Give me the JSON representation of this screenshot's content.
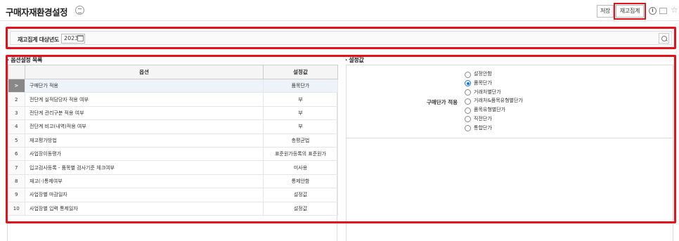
{
  "header": {
    "title": "구매자재환경설정",
    "title_icon": "list-icon",
    "buttons": {
      "save": "저장",
      "stock_calc": "재고집계"
    },
    "icons": [
      "info-icon",
      "mail-icon",
      "star-icon"
    ],
    "info_glyph": "i",
    "star_glyph": "☆"
  },
  "search": {
    "label": "재고집계 대상년도",
    "year": "2023"
  },
  "left_panel": {
    "title": "· 옵션설정 목록",
    "columns": {
      "option": "옵션",
      "value": "설정값"
    },
    "rows": [
      {
        "num": ">",
        "name": "구매단가 적용",
        "value": "품목단가",
        "selected": true
      },
      {
        "num": "2",
        "name": "전단계 실적담당자 적용 여부",
        "value": "부"
      },
      {
        "num": "3",
        "name": "전단계 관리구분 적용 여부",
        "value": "부"
      },
      {
        "num": "4",
        "name": "전단계 비고(내역)적용 여부",
        "value": "부"
      },
      {
        "num": "5",
        "name": "재고평가방법",
        "value": "총평균법"
      },
      {
        "num": "6",
        "name": "사업장이동평가",
        "value": "표준원가등록의 표준원가"
      },
      {
        "num": "7",
        "name": "입고검사등록 - 품목별 검사기준 체크여부",
        "value": "미사용"
      },
      {
        "num": "8",
        "name": "재고(-)통제여부",
        "value": "통제안함"
      },
      {
        "num": "9",
        "name": "사업장별 마감일자",
        "value": "설정값"
      },
      {
        "num": "10",
        "name": "사업장별 입력 통제일자",
        "value": "설정값"
      }
    ]
  },
  "right_panel": {
    "title": "· 설정값",
    "setting_label": "구매단가 적용",
    "options": [
      {
        "label": "설정안함",
        "checked": false
      },
      {
        "label": "품목단가",
        "checked": true
      },
      {
        "label": "거래처별단가",
        "checked": false
      },
      {
        "label": "거래처&품목유형별단가",
        "checked": false
      },
      {
        "label": "품목유형별단가",
        "checked": false
      },
      {
        "label": "직전단가",
        "checked": false
      },
      {
        "label": "통합단가",
        "checked": false
      }
    ]
  },
  "colors": {
    "highlight": "#e3121b",
    "accent": "#1a73e8"
  }
}
